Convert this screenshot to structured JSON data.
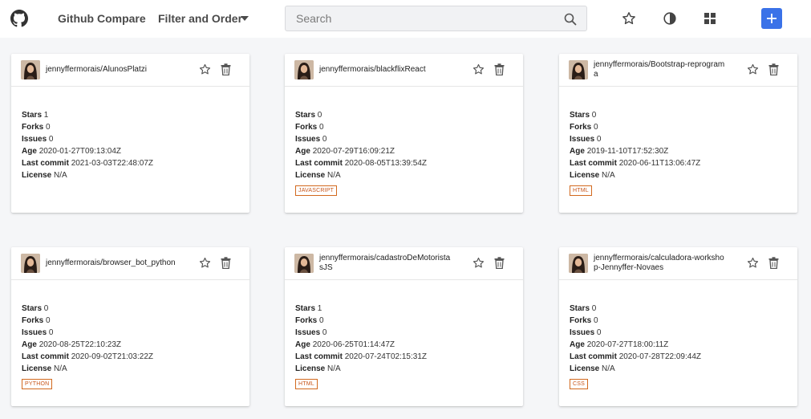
{
  "nav": {
    "logo": "github-logo",
    "compare_label": "Github Compare",
    "filter_label": "Filter and Order",
    "search_placeholder": "Search",
    "accent": "#3a72e8"
  },
  "labels": {
    "stars": "Stars",
    "forks": "Forks",
    "issues": "Issues",
    "age": "Age",
    "last_commit": "Last commit",
    "license": "License"
  },
  "cards": [
    {
      "title": "jennyffermorais/AlunosPlatzi",
      "stars": "1",
      "forks": "0",
      "issues": "0",
      "age": "2020-01-27T09:13:04Z",
      "last_commit": "2021-03-03T22:48:07Z",
      "license": "N/A",
      "language": ""
    },
    {
      "title": "jennyffermorais/blackflixReact",
      "stars": "0",
      "forks": "0",
      "issues": "0",
      "age": "2020-07-29T16:09:21Z",
      "last_commit": "2020-08-05T13:39:54Z",
      "license": "N/A",
      "language": "JAVASCRIPT"
    },
    {
      "title": "jennyffermorais/Bootstrap-reprograma",
      "stars": "0",
      "forks": "0",
      "issues": "0",
      "age": "2019-11-10T17:52:30Z",
      "last_commit": "2020-06-11T13:06:47Z",
      "license": "N/A",
      "language": "HTML"
    },
    {
      "title": "jennyffermorais/browser_bot_python",
      "stars": "0",
      "forks": "0",
      "issues": "0",
      "age": "2020-08-25T22:10:23Z",
      "last_commit": "2020-09-02T21:03:22Z",
      "license": "N/A",
      "language": "PYTHON"
    },
    {
      "title": "jennyffermorais/cadastroDeMotoristasJS",
      "stars": "1",
      "forks": "0",
      "issues": "0",
      "age": "2020-06-25T01:14:47Z",
      "last_commit": "2020-07-24T02:15:31Z",
      "license": "N/A",
      "language": "HTML"
    },
    {
      "title": "jennyffermorais/calculadora-workshop-Jennyffer-Novaes",
      "stars": "0",
      "forks": "0",
      "issues": "0",
      "age": "2020-07-27T18:00:11Z",
      "last_commit": "2020-07-28T22:09:44Z",
      "license": "N/A",
      "language": "CSS"
    }
  ]
}
